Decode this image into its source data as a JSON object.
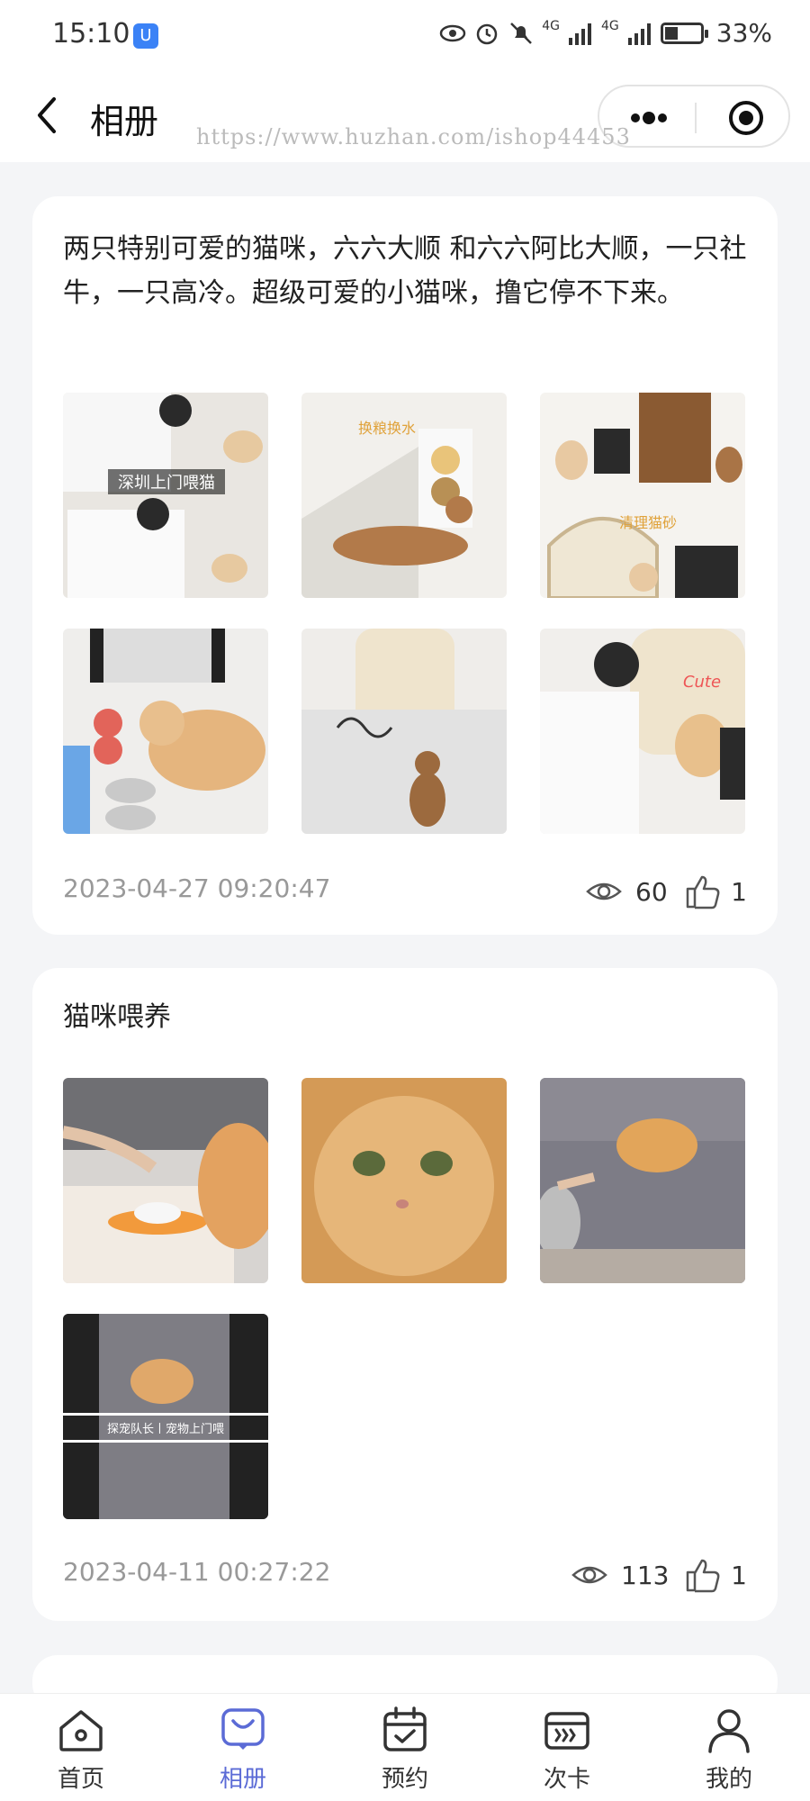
{
  "status_bar": {
    "time": "15:10",
    "network_1": "4G",
    "network_2": "4G",
    "battery": "33%",
    "battery_level": 0.33
  },
  "nav": {
    "title": "相册",
    "watermark": "https://www.huzhan.com/ishop44453"
  },
  "posts": [
    {
      "text": "两只特别可爱的猫咪，六六大顺 和六六阿比大顺，一只社牛，一只高冷。超级可爱的小猫咪，撸它停不下来。",
      "photos": [
        {
          "caption": "深圳上门喂猫"
        },
        {
          "caption": "换粮换水"
        },
        {
          "caption": "清理猫砂"
        },
        {
          "caption": ""
        },
        {
          "caption": ""
        },
        {
          "caption": "Cute"
        }
      ],
      "date": "2023-04-27 09:20:47",
      "views": "60",
      "likes": "1"
    },
    {
      "text": "猫咪喂养",
      "photos": [
        {
          "caption": ""
        },
        {
          "caption": ""
        },
        {
          "caption": ""
        },
        {
          "caption": "探宠队长丨宠物上门喂"
        }
      ],
      "date": "2023-04-11 00:27:22",
      "views": "113",
      "likes": "1"
    }
  ],
  "tabs": [
    {
      "label": "首页",
      "icon": "home-icon"
    },
    {
      "label": "相册",
      "icon": "album-icon",
      "active": true
    },
    {
      "label": "预约",
      "icon": "calendar-icon"
    },
    {
      "label": "次卡",
      "icon": "card-icon"
    },
    {
      "label": "我的",
      "icon": "user-icon"
    }
  ],
  "colors": {
    "accent": "#5b6bd6",
    "background": "#f4f5f7",
    "card": "#ffffff",
    "muted_text": "#999999"
  }
}
